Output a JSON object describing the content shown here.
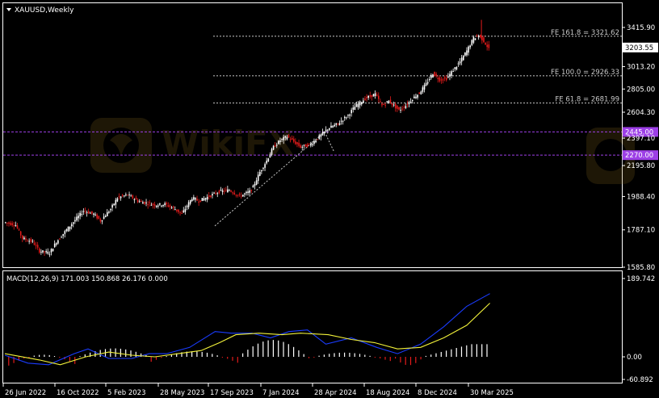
{
  "symbol_header": {
    "title": "XAUUSD,Weekly"
  },
  "colors": {
    "background": "#000000",
    "frame": "#ffffff",
    "bull_candle": "#ffffff",
    "bear_candle": "#e31b1b",
    "fib_lines": "#c8c8c8",
    "purple_levels": "#9d3fe6",
    "macd_line": "#1a3cff",
    "signal_line": "#f2f23a",
    "hist_positive": "#ffffff",
    "hist_negative": "#e31b1b"
  },
  "price_axis": {
    "ticks": [
      "3415.90",
      "3013.20",
      "2805.00",
      "2604.30",
      "2397.10",
      "2195.80",
      "1988.40",
      "1787.10",
      "1585.80"
    ],
    "current_price": "3203.55"
  },
  "fib_levels": [
    {
      "label": "FE 161.8 = 3321.62",
      "price": 3321.62
    },
    {
      "label": "FE 100.0 = 2926.33",
      "price": 2926.33
    },
    {
      "label": "FE 61.8 = 2681.99",
      "price": 2681.99
    }
  ],
  "horizontal_levels": [
    {
      "label": "2445.00",
      "price": 2445.0
    },
    {
      "label": "2270.00",
      "price": 2270.0
    }
  ],
  "macd_panel": {
    "title": "MACD(12,26,9) 171.003 150.868 26.176 0.000",
    "axis_ticks": [
      "189.742",
      "0.00",
      "-60.892"
    ]
  },
  "time_axis": {
    "labels": [
      "26 Jun 2022",
      "16 Oct 2022",
      "5 Feb 2023",
      "28 May 2023",
      "17 Sep 2023",
      "7 Jan 2024",
      "28 Apr 2024",
      "18 Aug 2024",
      "8 Dec 2024",
      "30 Mar 2025"
    ]
  },
  "watermark": {
    "text": "WikiFX"
  }
}
